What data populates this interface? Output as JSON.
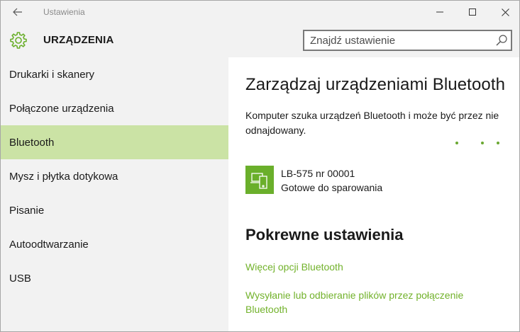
{
  "titlebar": {
    "app_title": "Ustawienia",
    "back_icon": "arrow-left-icon",
    "minimize_icon": "minimize-icon",
    "maximize_icon": "maximize-icon",
    "close_icon": "close-icon"
  },
  "header": {
    "title": "URZĄDZENIA",
    "icon": "gear-icon",
    "search": {
      "placeholder": "Znajdź ustawienie",
      "value": ""
    }
  },
  "sidebar": {
    "items": [
      {
        "label": "Drukarki i skanery"
      },
      {
        "label": "Połączone urządzenia"
      },
      {
        "label": "Bluetooth"
      },
      {
        "label": "Mysz i płytka dotykowa"
      },
      {
        "label": "Pisanie"
      },
      {
        "label": "Autoodtwarzanie"
      },
      {
        "label": "USB"
      }
    ],
    "selected_label": "Bluetooth"
  },
  "main": {
    "title": "Zarządzaj urządzeniami Bluetooth",
    "searching_text": "Komputer szuka urządzeń Bluetooth i może być przez nie odnajdowany.",
    "device": {
      "icon": "phone-laptop-icon",
      "name": "LB-575 nr 00001",
      "status": "Gotowe do sparowania"
    },
    "related": {
      "title": "Pokrewne ustawienia",
      "links": [
        {
          "label": "Więcej opcji Bluetooth"
        },
        {
          "label": "Wysyłanie lub odbieranie plików przez połączenie Bluetooth"
        }
      ]
    }
  },
  "colors": {
    "accent": "#6aaf2b",
    "selected_bg": "#cbe3a5",
    "link": "#72b22b",
    "panel_bg": "#f2f2f2"
  }
}
